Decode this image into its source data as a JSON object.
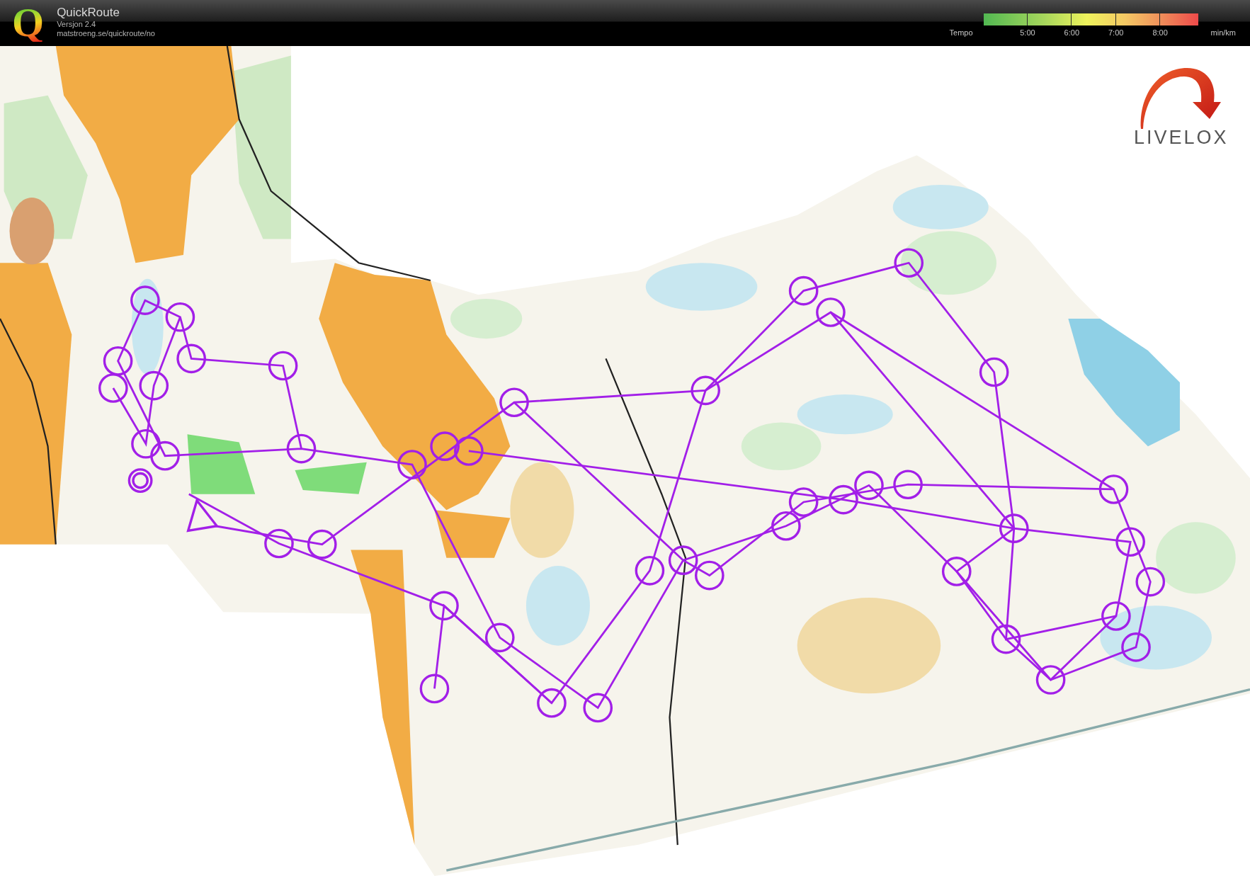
{
  "header": {
    "logo_letter": "Q",
    "app_name": "QuickRoute",
    "version": "Versjon 2.4",
    "url": "matstroeng.se/quickroute/no"
  },
  "tempo_legend": {
    "label": "Tempo",
    "ticks": [
      "5:00",
      "6:00",
      "7:00",
      "8:00"
    ],
    "unit": "min/km"
  },
  "map_overlay": {
    "brand": "LIVELOX"
  }
}
